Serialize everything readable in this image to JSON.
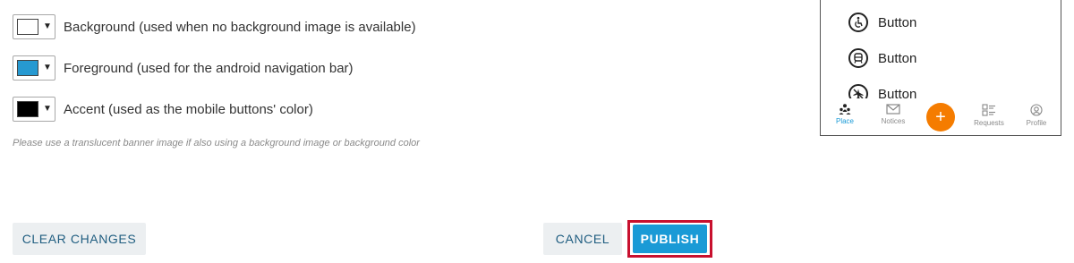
{
  "colors": {
    "background": {
      "label": "Background (used when no background image is available)",
      "swatch": "#ffffff"
    },
    "foreground": {
      "label": "Foreground (used for the android navigation bar)",
      "swatch": "#2699d1"
    },
    "accent": {
      "label": "Accent (used as the mobile buttons' color)",
      "swatch": "#000000"
    },
    "hint": "Please use a translucent banner image if also using a background image or background color"
  },
  "actions": {
    "clear_label": "CLEAR CHANGES",
    "cancel_label": "CANCEL",
    "publish_label": "PUBLISH",
    "publish_color": "#1a9ad6",
    "highlight_color": "#c8102e"
  },
  "preview": {
    "buttons": [
      {
        "label": "Button",
        "icon": "accessibility-icon"
      },
      {
        "label": "Button",
        "icon": "train-icon"
      },
      {
        "label": "Button",
        "icon": "no-flight-icon"
      }
    ],
    "tabs": [
      {
        "label": "Place",
        "icon": "people-icon",
        "active": true
      },
      {
        "label": "Notices",
        "icon": "mail-icon",
        "active": false
      },
      {
        "label": "Requests",
        "icon": "list-icon",
        "active": false
      },
      {
        "label": "Profile",
        "icon": "profile-icon",
        "active": false
      }
    ],
    "fab_symbol": "+",
    "fab_color": "#f57c00"
  }
}
